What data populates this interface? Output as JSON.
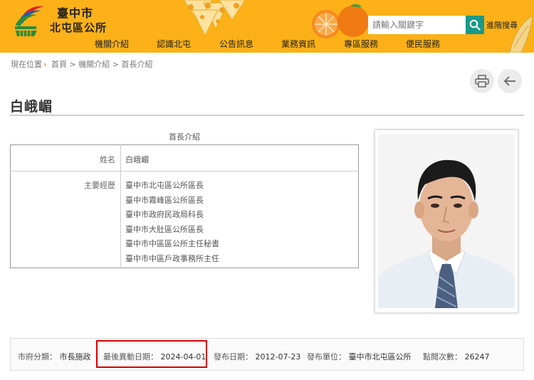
{
  "header": {
    "org_line1": "臺中市",
    "org_line2": "北屯區公所",
    "search_placeholder": "請輸入關鍵字",
    "advanced_search": "進階搜尋",
    "nav": [
      {
        "label": "機關介紹"
      },
      {
        "label": "認識北屯"
      },
      {
        "label": "公告訊息"
      },
      {
        "label": "業務資訊"
      },
      {
        "label": "專區服務"
      },
      {
        "label": "便民服務"
      }
    ]
  },
  "breadcrumb": {
    "here": "現在位置",
    "items": [
      "首頁",
      "機關介紹",
      "首長介紹"
    ],
    "separator": ">"
  },
  "page": {
    "title": "白峨嵋"
  },
  "table": {
    "caption": "首長介紹",
    "name_label": "姓名",
    "name_value": "白峨嵋",
    "experience_label": "主要經歷",
    "experience": [
      "臺中市北屯區公所區長",
      "臺中市霧峰區公所區長",
      "臺中市政府民政局科長",
      "臺中市大肚區公所區長",
      "臺中市中區區公所主任秘書",
      "臺中市中區戶政事務所主任"
    ]
  },
  "meta": {
    "category_label": "市府分類：",
    "category_value": "市長施政",
    "updated_label": "最後異動日期：",
    "updated_value": "2024-04-01",
    "published_label": "發布日期：",
    "published_value": "2012-07-23",
    "unit_label": "發布單位：",
    "unit_value": "臺中市北屯區公所",
    "views_label": "點閱次數：",
    "views_value": "26247"
  },
  "colors": {
    "header_bg": "#fbb117",
    "search_button": "#1a9a88",
    "highlight": "#d90000"
  },
  "icons": {
    "search": "search-icon",
    "print": "print-icon",
    "back": "back-arrow-icon"
  }
}
